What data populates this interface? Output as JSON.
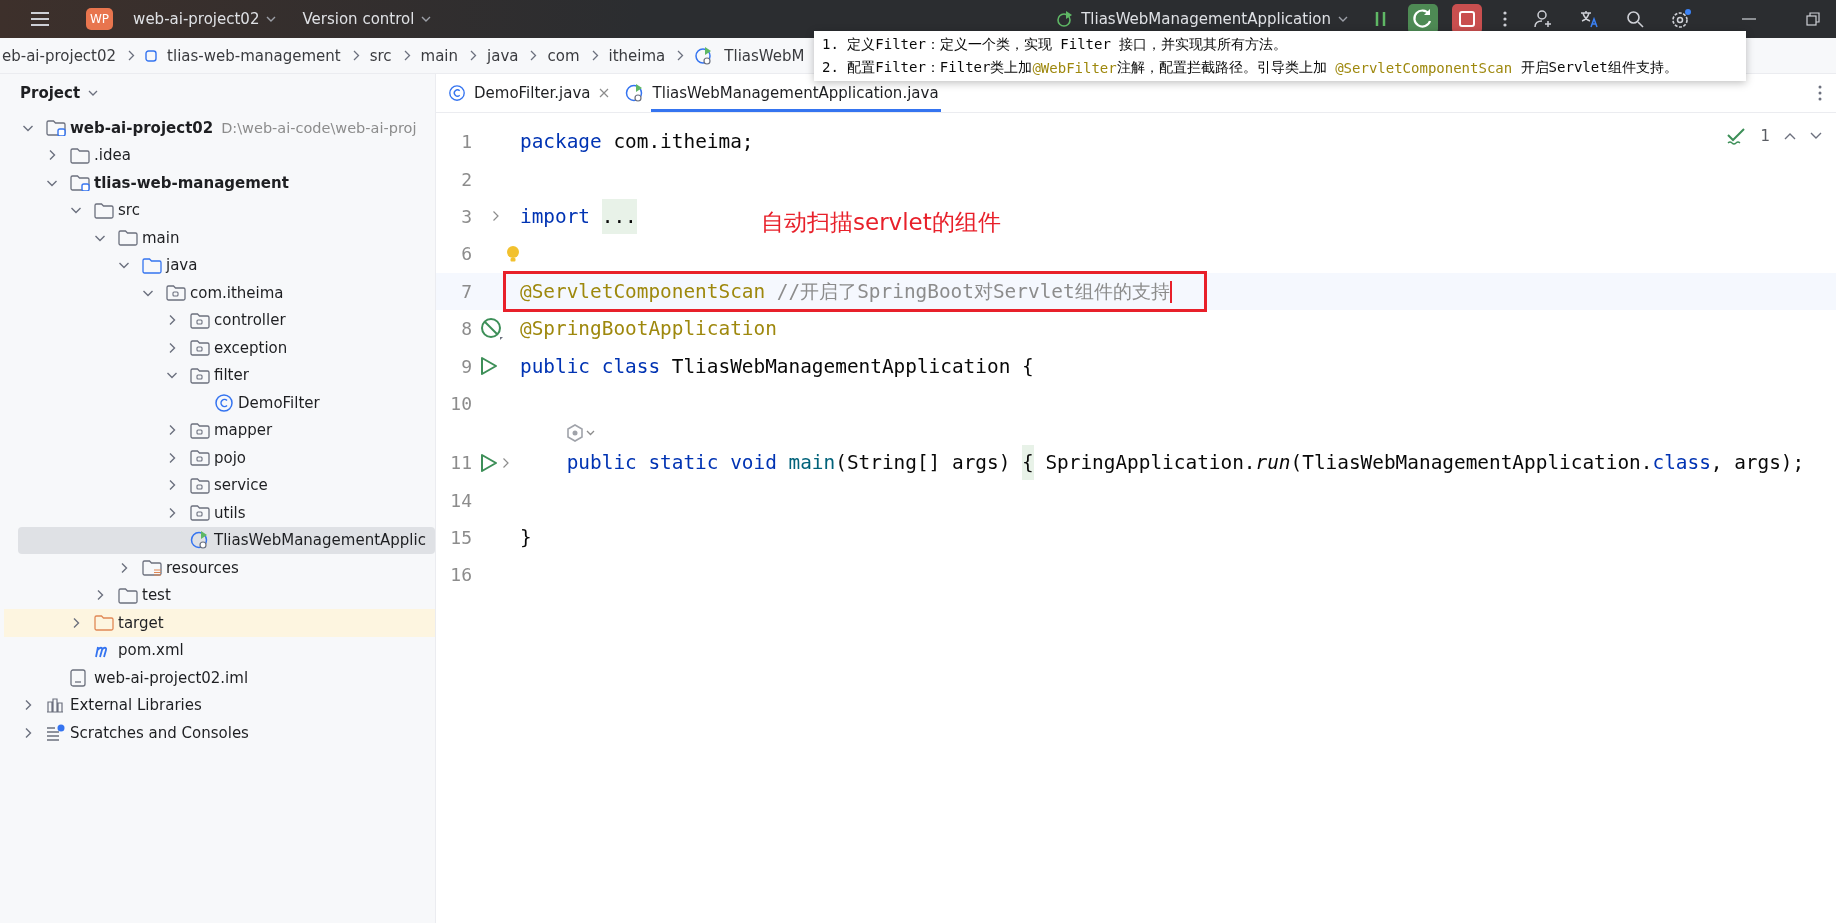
{
  "title_bar": {
    "project_badge": "WP",
    "project": "web-ai-project02",
    "vcs": "Version control",
    "run_config": "TliasWebManagementApplication"
  },
  "breadcrumbs": [
    {
      "label": "eb-ai-project02",
      "kind": "plain"
    },
    {
      "label": "tlias-web-management",
      "kind": "module"
    },
    {
      "label": "src",
      "kind": "plain"
    },
    {
      "label": "main",
      "kind": "plain"
    },
    {
      "label": "java",
      "kind": "plain"
    },
    {
      "label": "com",
      "kind": "plain"
    },
    {
      "label": "itheima",
      "kind": "plain"
    },
    {
      "label": "TliasWebM",
      "kind": "app-class"
    }
  ],
  "project_panel": {
    "title": "Project",
    "tree": [
      {
        "label": "web-ai-project02",
        "hint": "D:\\web-ai-code\\web-ai-proj",
        "kind": "module",
        "expanded": true,
        "selected": false,
        "children": [
          {
            "label": ".idea",
            "kind": "folder",
            "expanded": false,
            "selected": false
          },
          {
            "label": "tlias-web-management",
            "kind": "module",
            "expanded": true,
            "selected": false,
            "children": [
              {
                "label": "src",
                "kind": "folder",
                "expanded": true,
                "selected": false,
                "children": [
                  {
                    "label": "main",
                    "kind": "folder",
                    "expanded": true,
                    "selected": false,
                    "children": [
                      {
                        "label": "java",
                        "kind": "source-folder",
                        "expanded": true,
                        "selected": false,
                        "children": [
                          {
                            "label": "com.itheima",
                            "kind": "package",
                            "expanded": true,
                            "selected": false,
                            "children": [
                              {
                                "label": "controller",
                                "kind": "package",
                                "expanded": false,
                                "selected": false
                              },
                              {
                                "label": "exception",
                                "kind": "package",
                                "expanded": false,
                                "selected": false
                              },
                              {
                                "label": "filter",
                                "kind": "package",
                                "expanded": true,
                                "selected": false,
                                "children": [
                                  {
                                    "label": "DemoFilter",
                                    "kind": "class",
                                    "selected": false
                                  }
                                ]
                              },
                              {
                                "label": "mapper",
                                "kind": "package",
                                "expanded": false,
                                "selected": false
                              },
                              {
                                "label": "pojo",
                                "kind": "package",
                                "expanded": false,
                                "selected": false
                              },
                              {
                                "label": "service",
                                "kind": "package",
                                "expanded": false,
                                "selected": false
                              },
                              {
                                "label": "utils",
                                "kind": "package",
                                "expanded": false,
                                "selected": false
                              },
                              {
                                "label": "TliasWebManagementApplic",
                                "kind": "app-class",
                                "selected": true
                              }
                            ]
                          }
                        ]
                      },
                      {
                        "label": "resources",
                        "kind": "resources",
                        "expanded": false,
                        "selected": false
                      }
                    ]
                  },
                  {
                    "label": "test",
                    "kind": "folder",
                    "expanded": false,
                    "selected": false
                  }
                ]
              },
              {
                "label": "target",
                "kind": "excluded-folder",
                "expanded": false,
                "selected": false
              },
              {
                "label": "pom.xml",
                "kind": "maven",
                "selected": false
              }
            ]
          },
          {
            "label": "web-ai-project02.iml",
            "kind": "iml",
            "selected": false
          }
        ]
      },
      {
        "label": "External Libraries",
        "kind": "libraries",
        "expanded": false,
        "selected": false
      },
      {
        "label": "Scratches and Consoles",
        "kind": "scratches",
        "expanded": false,
        "selected": false
      }
    ]
  },
  "tabs": [
    {
      "label": "DemoFilter.java",
      "kind": "class",
      "selected": false
    },
    {
      "label": "TliasWebManagementApplication.java",
      "kind": "app-class",
      "selected": true
    }
  ],
  "inspection": {
    "count": "1"
  },
  "editor": {
    "lines": [
      {
        "kind": "plain",
        "number": "1",
        "tokens": [
          {
            "kind": "kw",
            "text": "package "
          },
          {
            "kind": "plain",
            "text": "com.itheima;"
          }
        ]
      },
      {
        "kind": "plain",
        "number": "2"
      },
      {
        "kind": "fold",
        "number": "3",
        "tokens": [
          {
            "kind": "kw",
            "text": "import "
          },
          {
            "kind": "folded",
            "text": "..."
          }
        ]
      },
      {
        "kind": "bulb",
        "number": "6"
      },
      {
        "kind": "plain",
        "number": "7",
        "current": true,
        "boxed": true,
        "tokens": [
          {
            "kind": "ann",
            "text": "@ServletComponentScan "
          },
          {
            "kind": "comment",
            "text": "//开启了SpringBoot对Servlet组件的支持"
          }
        ]
      },
      {
        "kind": "blocked",
        "number": "8",
        "tokens": [
          {
            "kind": "ann",
            "text": "@SpringBootApplication"
          }
        ]
      },
      {
        "kind": "run",
        "number": "9",
        "tokens": [
          {
            "kind": "kw",
            "text": "public class "
          },
          {
            "kind": "plain",
            "text": "TliasWebManagementApplication {"
          }
        ]
      },
      {
        "kind": "plain",
        "number": "10"
      },
      {
        "kind": "inlay"
      },
      {
        "kind": "run-fold",
        "number": "11",
        "tokens": [
          {
            "kind": "kw",
            "text": "    public static void "
          },
          {
            "kind": "method",
            "text": "main"
          },
          {
            "kind": "plain",
            "text": "(String[] args) "
          },
          {
            "kind": "folded",
            "text": "{"
          },
          {
            "kind": "plain",
            "text": " SpringApplication."
          },
          {
            "kind": "italic",
            "text": "run"
          },
          {
            "kind": "plain",
            "text": "(TliasWebManagementApplication."
          },
          {
            "kind": "kw",
            "text": "class"
          },
          {
            "kind": "plain",
            "text": ", args);"
          }
        ]
      },
      {
        "kind": "plain",
        "number": "14"
      },
      {
        "kind": "plain",
        "number": "15",
        "tokens": [
          {
            "kind": "plain",
            "text": "}"
          }
        ]
      },
      {
        "kind": "plain",
        "number": "16"
      }
    ]
  },
  "callout": "自动扫描servlet的组件",
  "tooltip": {
    "lines": [
      [
        {
          "kind": "plain",
          "text": "1. 定义Filter：定义一个类，实现 Filter 接口，并实现其所有方法。"
        }
      ],
      [
        {
          "kind": "plain",
          "text": "2. 配置Filter：Filter类上加"
        },
        {
          "kind": "ann",
          "text": "@WebFilter"
        },
        {
          "kind": "plain",
          "text": "注解，配置拦截路径。引导类上加 "
        },
        {
          "kind": "ann",
          "text": "@ServletComponentScan"
        },
        {
          "kind": "plain",
          "text": " 开启Servlet组件支持。"
        }
      ]
    ]
  }
}
